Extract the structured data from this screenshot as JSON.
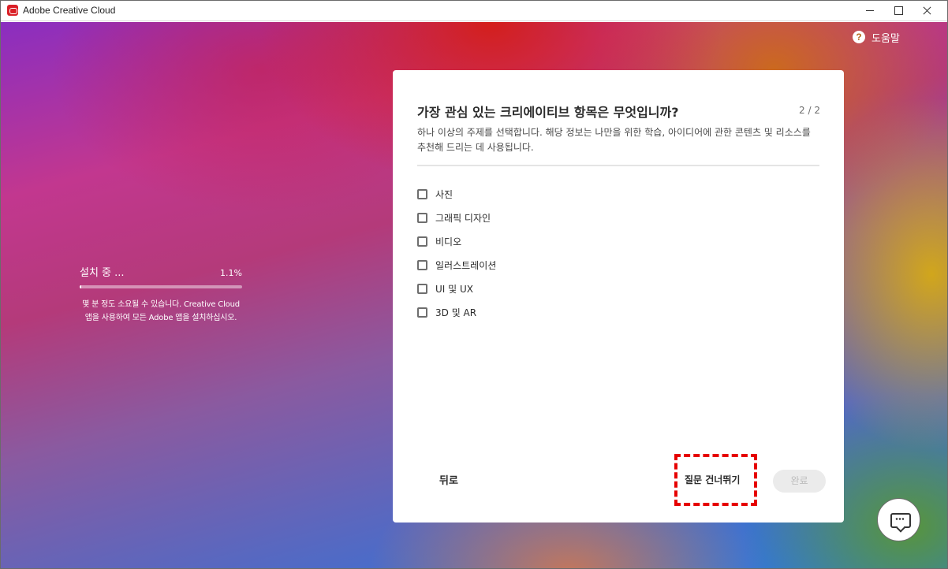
{
  "window": {
    "title": "Adobe Creative Cloud"
  },
  "help": {
    "label": "도움말"
  },
  "install": {
    "status": "설치 중 ...",
    "percent_text": "1.1%",
    "progress": 0.011,
    "note": "몇 분 정도 소요될 수 있습니다. Creative Cloud 앱을 사용하여 모든 Adobe 앱을 설치하십시오."
  },
  "question": {
    "title": "가장 관심 있는 크리에이티브 항목은 무엇입니까?",
    "step": "2 / 2",
    "description": "하나 이상의 주제를 선택합니다. 해당 정보는 나만을 위한 학습, 아이디어에 관한 콘텐츠 및 리소스를 추천해 드리는 데 사용됩니다.",
    "options": [
      {
        "label": "사진",
        "checked": false
      },
      {
        "label": "그래픽 디자인",
        "checked": false
      },
      {
        "label": "비디오",
        "checked": false
      },
      {
        "label": "일러스트레이션",
        "checked": false
      },
      {
        "label": "UI 및 UX",
        "checked": false
      },
      {
        "label": "3D 및 AR",
        "checked": false
      }
    ]
  },
  "actions": {
    "back": "뒤로",
    "skip": "질문 건너뛰기",
    "done": "완료"
  },
  "colors": {
    "highlight": "#e60000",
    "brand": "#da1f26"
  }
}
